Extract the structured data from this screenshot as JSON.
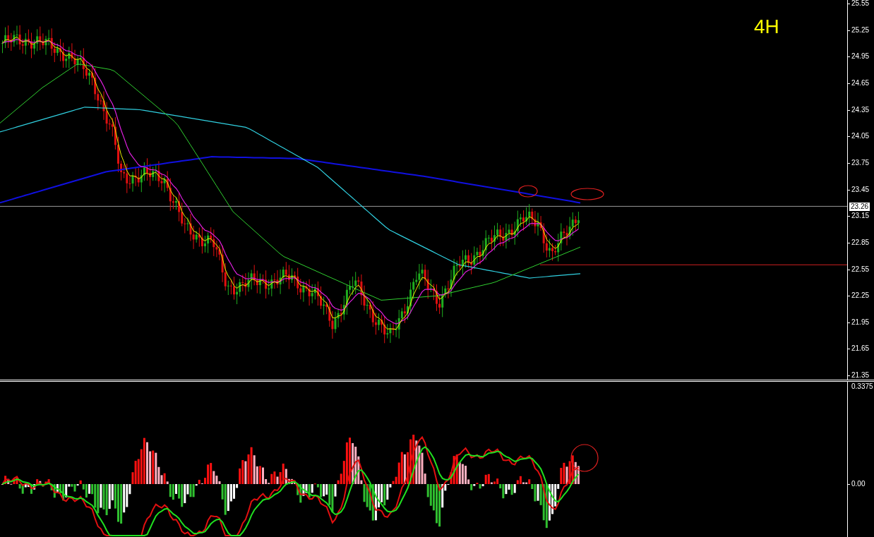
{
  "timeframe": "4H",
  "price_axis": {
    "labels": [
      "25.55",
      "25.25",
      "24.95",
      "24.65",
      "24.35",
      "24.05",
      "23.75",
      "23.45",
      "23.15",
      "22.85",
      "22.55",
      "22.25",
      "21.95",
      "21.65",
      "21.35"
    ],
    "current_price": "23.26"
  },
  "indicator_axis": {
    "labels": [
      "0.3375",
      "0.00"
    ]
  }
}
